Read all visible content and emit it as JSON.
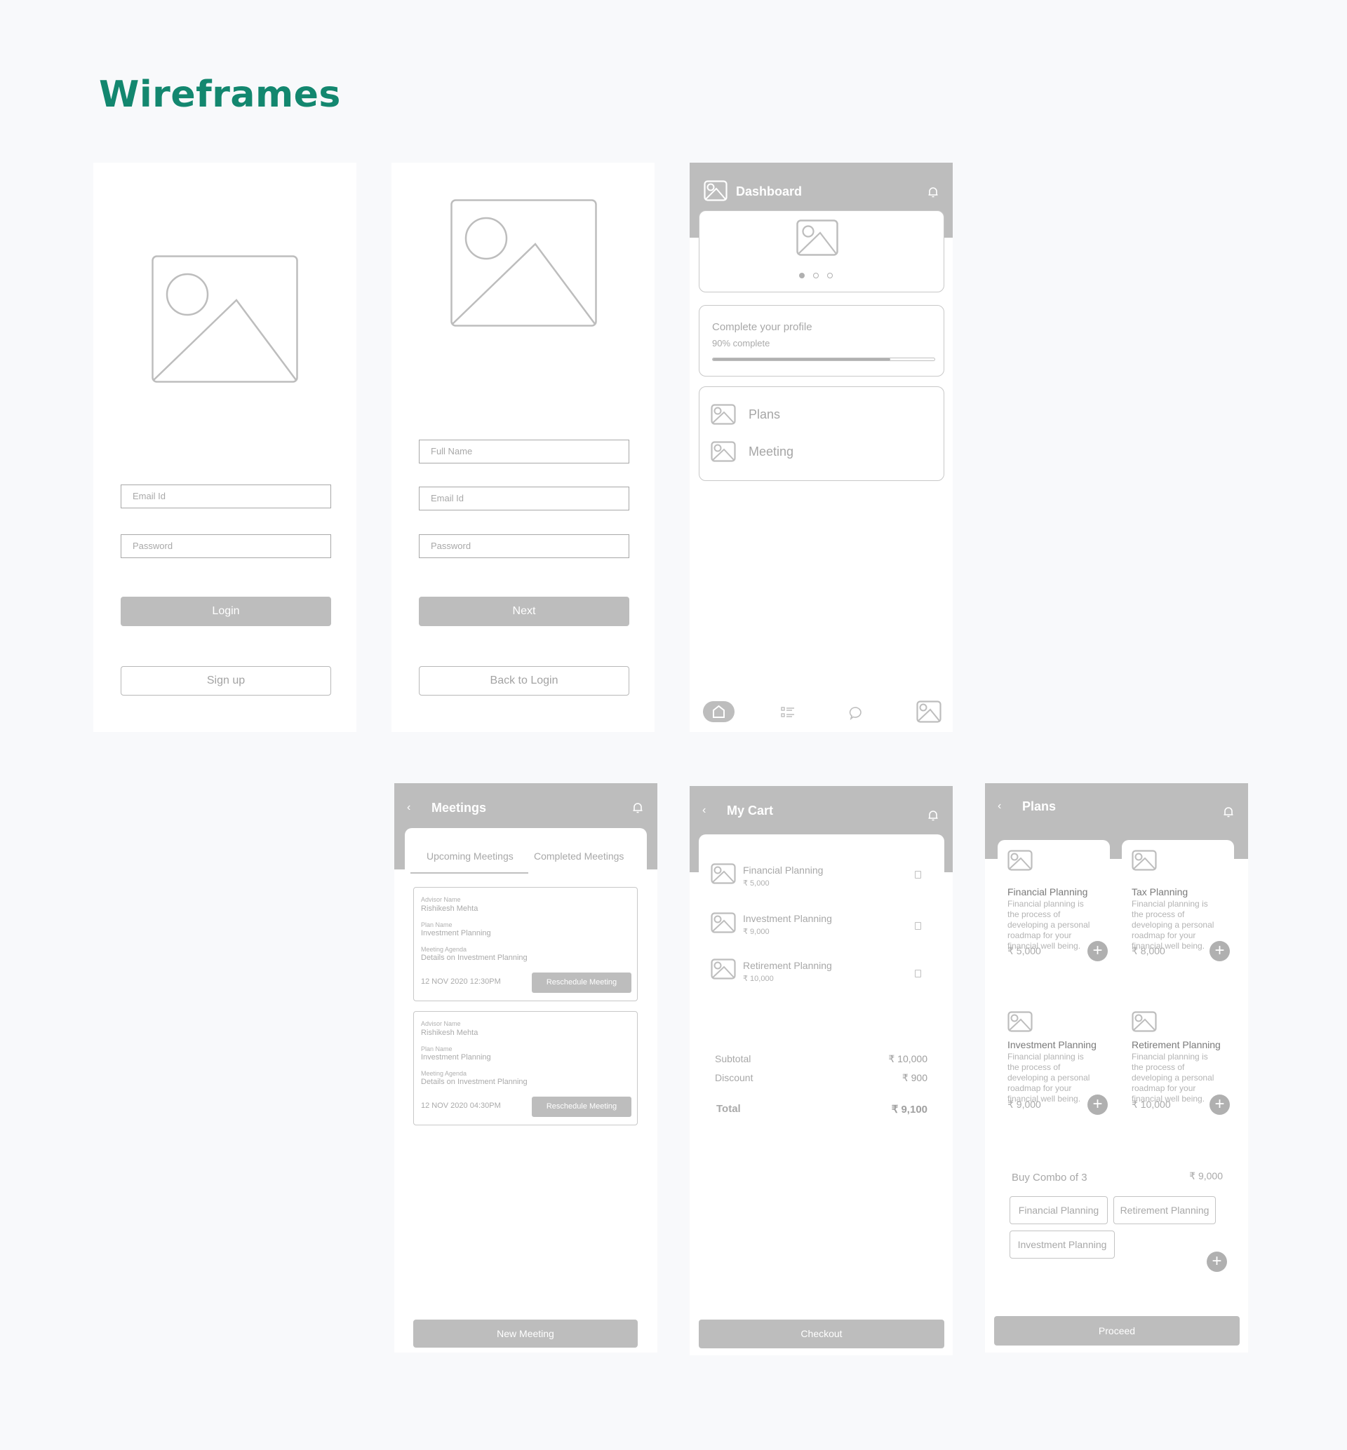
{
  "page_title": "Wireframes",
  "colors": {
    "accent": "#13876f",
    "gray_fill": "#bdbdbd",
    "border": "#c8c8c8"
  },
  "login": {
    "email_placeholder": "Email Id",
    "password_placeholder": "Password",
    "login_label": "Login",
    "signup_label": "Sign up"
  },
  "signup": {
    "fullname_placeholder": "Full Name",
    "email_placeholder": "Email Id",
    "password_placeholder": "Password",
    "next_label": "Next",
    "back_label": "Back to Login"
  },
  "dashboard": {
    "title": "Dashboard",
    "profile_title": "Complete your profile",
    "profile_status": "90% complete",
    "progress_fraction": 0.8,
    "carousel_pages": 3,
    "carousel_active": 0,
    "menu": [
      {
        "label": "Plans",
        "icon": "image-icon"
      },
      {
        "label": "Meeting",
        "icon": "image-icon"
      }
    ],
    "nav": [
      "home-icon",
      "list-icon",
      "chat-icon",
      "profile-image-icon"
    ]
  },
  "meetings": {
    "title": "Meetings",
    "tabs": [
      "Upcoming Meetings",
      "Completed Meetings"
    ],
    "active_tab": 0,
    "labels": {
      "advisor": "Advisor Name",
      "plan": "Plan Name",
      "agenda": "Meeting Agenda"
    },
    "items": [
      {
        "advisor": "Rishikesh Mehta",
        "plan": "Investment Planning",
        "agenda": "Details on Investment Planning",
        "datetime": "12 NOV 2020 12:30PM",
        "action": "Reschedule Meeting"
      },
      {
        "advisor": "Rishikesh Mehta",
        "plan": "Investment Planning",
        "agenda": "Details on Investment Planning",
        "datetime": "12 NOV 2020 04:30PM",
        "action": "Reschedule Meeting"
      }
    ],
    "new_meeting_label": "New Meeting"
  },
  "cart": {
    "title": "My Cart",
    "items": [
      {
        "name": "Financial Planning",
        "price": "₹ 5,000"
      },
      {
        "name": "Investment Planning",
        "price": "₹ 9,000"
      },
      {
        "name": "Retirement Planning",
        "price": "₹ 10,000"
      }
    ],
    "subtotal_label": "Subtotal",
    "subtotal": "₹ 10,000",
    "discount_label": "Discount",
    "discount": "₹ 900",
    "total_label": "Total",
    "total": "₹ 9,100",
    "checkout_label": "Checkout"
  },
  "plans": {
    "title": "Plans",
    "cards": [
      {
        "name": "Financial Planning",
        "desc": "Financial planning is the process of developing a personal roadmap for your financial well being.",
        "price": "₹ 5,000"
      },
      {
        "name": "Tax Planning",
        "desc": "Financial planning is the process of developing a personal roadmap for your financial well being.",
        "price": "₹ 8,000"
      },
      {
        "name": "Investment Planning",
        "desc": "Financial planning is the process of developing a personal roadmap for your financial well being.",
        "price": "₹ 9,000"
      },
      {
        "name": "Retirement Planning",
        "desc": "Financial planning is the process of developing a personal roadmap for your financial well being.",
        "price": "₹ 10,000"
      }
    ],
    "combo_label": "Buy Combo of 3",
    "combo_price": "₹ 9,000",
    "combo_chips": [
      "Financial Planning",
      "Retirement Planning",
      "Investment Planning"
    ],
    "proceed_label": "Proceed"
  }
}
